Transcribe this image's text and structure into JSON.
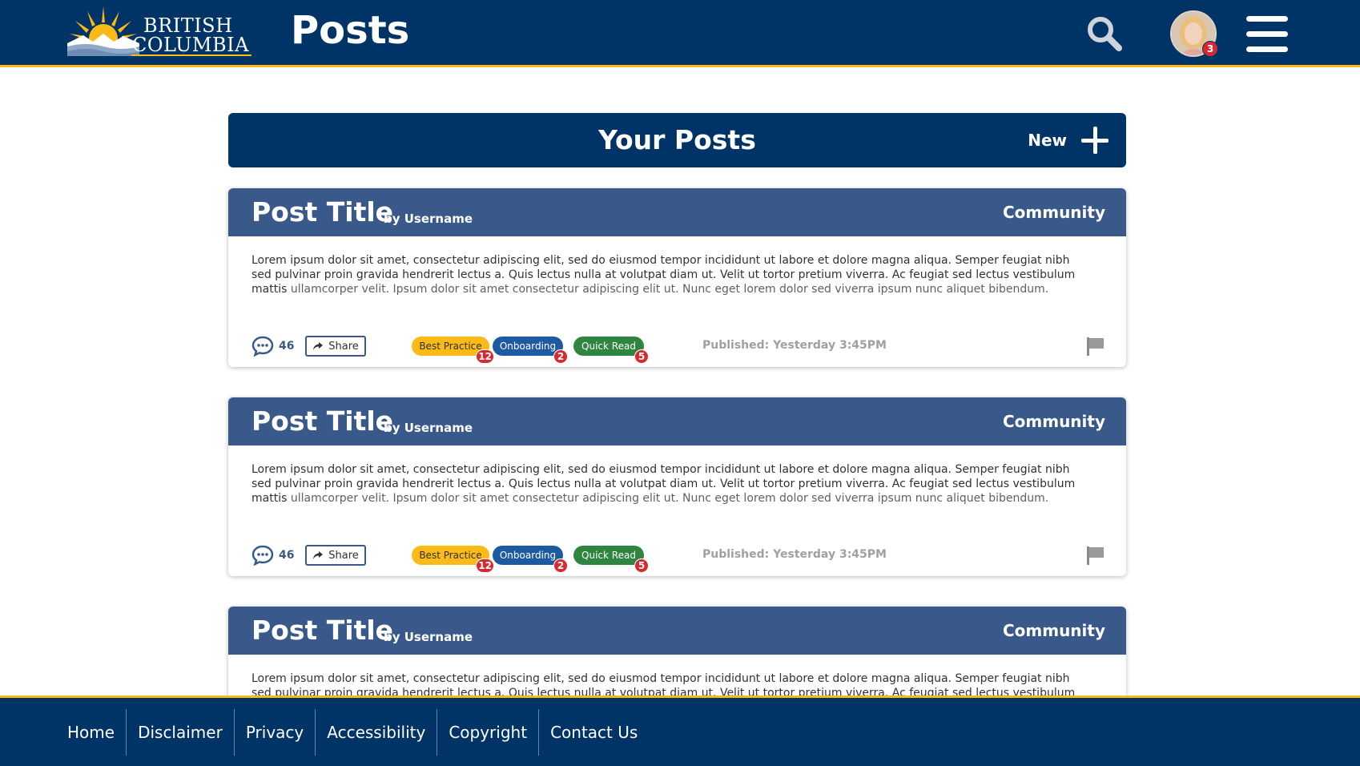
{
  "header": {
    "logo_line1": "BRITISH",
    "logo_line2": "COLUMBIA",
    "page_title": "Posts",
    "notification_count": "3"
  },
  "main": {
    "section_title": "Your Posts",
    "new_label": "New"
  },
  "posts": [
    {
      "title": "Post Title",
      "by": "by Username",
      "category": "Community",
      "body_main": "Lorem ipsum dolor sit amet, consectetur adipiscing elit, sed do eiusmod tempor incididunt ut labore et dolore magna aliqua. Semper feugiat nibh sed pulvinar proin gravida hendrerit lectus a. Quis lectus nulla at volutpat diam ut. Velit ut tortor pretium viverra. Ac feugiat sed lectus vestibulum mattis",
      "body_fade": "ullamcorper velit. Ipsum dolor sit amet consectetur adipiscing elit ut. Nunc eget lorem dolor sed viverra ipsum nunc aliquet bibendum.",
      "comments": "46",
      "share_label": "Share",
      "tags": [
        {
          "label": "Best Practice",
          "count": "12"
        },
        {
          "label": "Onboarding",
          "count": "2"
        },
        {
          "label": "Quick Read",
          "count": "5"
        }
      ],
      "published": "Published: Yesterday 3:45PM"
    },
    {
      "title": "Post Title",
      "by": "by Username",
      "category": "Community",
      "body_main": "Lorem ipsum dolor sit amet, consectetur adipiscing elit, sed do eiusmod tempor incididunt ut labore et dolore magna aliqua. Semper feugiat nibh sed pulvinar proin gravida hendrerit lectus a. Quis lectus nulla at volutpat diam ut. Velit ut tortor pretium viverra. Ac feugiat sed lectus vestibulum mattis",
      "body_fade": "ullamcorper velit. Ipsum dolor sit amet consectetur adipiscing elit ut. Nunc eget lorem dolor sed viverra ipsum nunc aliquet bibendum.",
      "comments": "46",
      "share_label": "Share",
      "tags": [
        {
          "label": "Best Practice",
          "count": "12"
        },
        {
          "label": "Onboarding",
          "count": "2"
        },
        {
          "label": "Quick Read",
          "count": "5"
        }
      ],
      "published": "Published: Yesterday 3:45PM"
    },
    {
      "title": "Post Title",
      "by": "by Username",
      "category": "Community",
      "body_main": "Lorem ipsum dolor sit amet, consectetur adipiscing elit, sed do eiusmod tempor incididunt ut labore et dolore magna aliqua. Semper feugiat nibh sed pulvinar proin gravida hendrerit lectus a. Quis lectus nulla at volutpat diam ut. Velit ut tortor pretium viverra. Ac feugiat sed lectus vestibulum mattis"
    }
  ],
  "footer": {
    "links": [
      "Home",
      "Disclaimer",
      "Privacy",
      "Accessibility",
      "Copyright",
      "Contact Us"
    ]
  },
  "colors": {
    "brand_blue": "#003366",
    "card_header": "#38598a",
    "accent_gold": "#fcba19",
    "badge_red": "#d8292f",
    "tag_onboarding": "#1e5aa1",
    "tag_quick_read": "#2e8540"
  },
  "icons": [
    "search-icon",
    "avatar",
    "hamburger-menu-icon",
    "plus-icon",
    "comment-icon",
    "share-icon",
    "flag-icon"
  ]
}
